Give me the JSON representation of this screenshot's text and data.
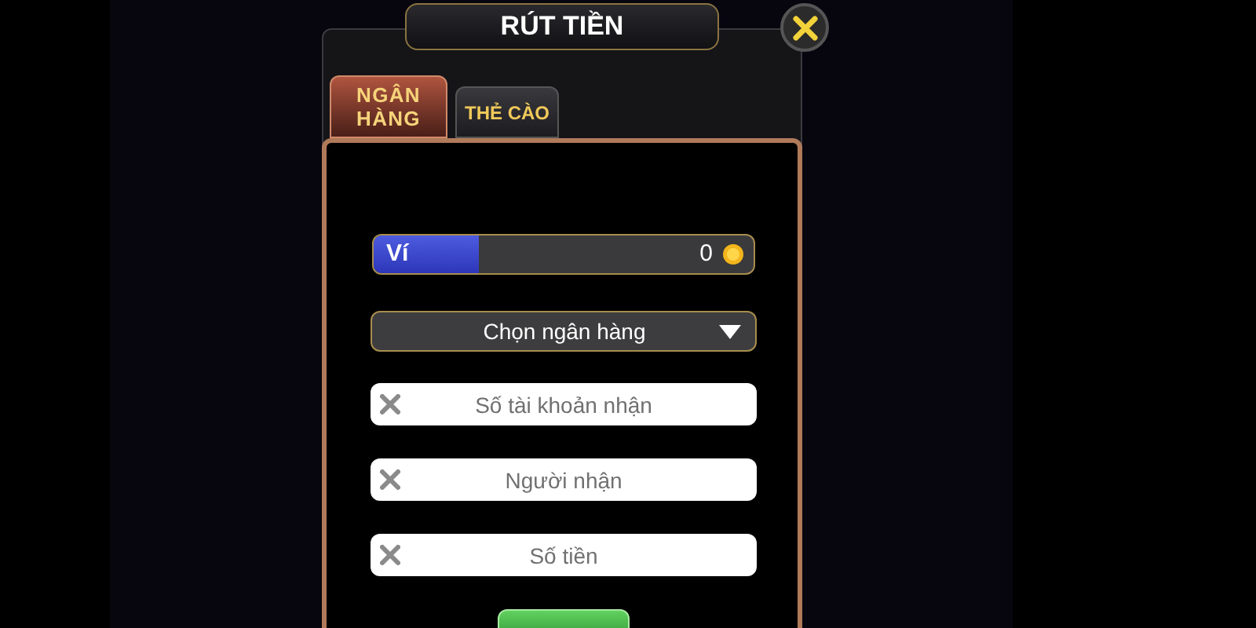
{
  "dialog": {
    "title": "RÚT TIỀN"
  },
  "tabs": [
    {
      "label": "NGÂN HÀNG",
      "selected": true
    },
    {
      "label": "THẺ CÀO",
      "selected": false
    }
  ],
  "wallet": {
    "label": "Ví",
    "amount": "0"
  },
  "bank_select": {
    "value": "Chọn ngân hàng"
  },
  "fields": [
    {
      "placeholder": "Số tài khoản nhận"
    },
    {
      "placeholder": "Người nhận"
    },
    {
      "placeholder": "Số tiền"
    }
  ]
}
